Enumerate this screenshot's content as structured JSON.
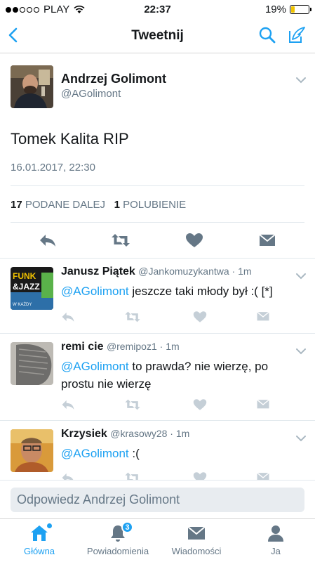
{
  "status_bar": {
    "carrier": "PLAY",
    "time": "22:37",
    "battery": "19%",
    "battery_level": 0.19,
    "signal_dots_filled": 2,
    "signal_dots_total": 5
  },
  "nav": {
    "title": "Tweetnij",
    "back_icon": "chevron-left-icon",
    "search_icon": "search-icon",
    "compose_icon": "compose-icon"
  },
  "main_tweet": {
    "name": "Andrzej Golimont",
    "handle": "@AGolimont",
    "text": "Tomek Kalita RIP",
    "date": "16.01.2017, 22:30",
    "retweets_count": "17",
    "retweets_label": "PODANE DALEJ",
    "likes_count": "1",
    "likes_label": "POLUBIENIE"
  },
  "replies": [
    {
      "name": "Janusz Piątek",
      "handle": "@Jankomuzykantwa",
      "time": "1m",
      "mention": "@AGolimont",
      "text": " jeszcze taki młody był :( [*]",
      "avatar_text": "FUNK & JAZZ"
    },
    {
      "name": "remi cie",
      "handle": "@remipoz1",
      "time": "1m",
      "mention": "@AGolimont",
      "text": " to prawda? nie wierzę, po prostu nie wierzę"
    },
    {
      "name": "Krzysiek",
      "handle": "@krasowy28",
      "time": "1m",
      "mention": "@AGolimont",
      "text": " :("
    }
  ],
  "reply_box": {
    "placeholder": "Odpowiedz Andrzej Golimont"
  },
  "tabs": [
    {
      "label": "Główna",
      "icon": "home-icon",
      "active": true
    },
    {
      "label": "Powiadomienia",
      "icon": "bell-icon",
      "badge": "3"
    },
    {
      "label": "Wiadomości",
      "icon": "envelope-icon"
    },
    {
      "label": "Ja",
      "icon": "person-icon"
    }
  ],
  "colors": {
    "accent": "#1da1f2",
    "text": "#14171a",
    "muted": "#657786",
    "icon_gray": "#8899a6"
  }
}
